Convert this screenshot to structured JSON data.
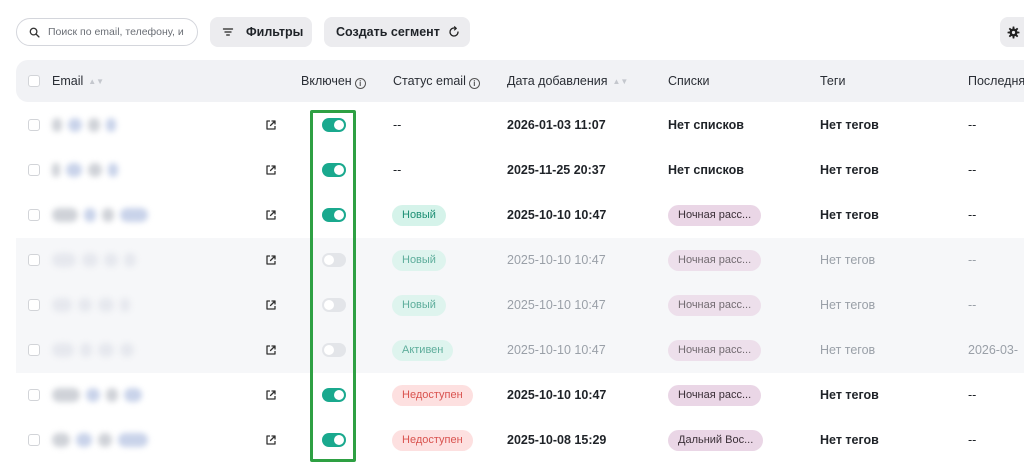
{
  "toolbar": {
    "search_placeholder": "Поиск по email, телефону, и",
    "filters_label": "Фильтры",
    "create_segment_label": "Создать сегмент"
  },
  "table": {
    "headers": {
      "email": "Email",
      "enabled": "Включен",
      "email_status": "Статус email",
      "date_added": "Дата добавления",
      "lists": "Списки",
      "tags": "Теги",
      "last": "Последня"
    },
    "rows": [
      {
        "enabled": true,
        "status": "--",
        "date": "2026-01-03 11:07",
        "list": "Нет списков",
        "tags": "Нет тегов",
        "last": "--"
      },
      {
        "enabled": true,
        "status": "--",
        "date": "2025-11-25 20:37",
        "list": "Нет списков",
        "tags": "Нет тегов",
        "last": "--"
      },
      {
        "enabled": true,
        "status": "Новый",
        "date": "2025-10-10 10:47",
        "list": "Ночная расс...",
        "tags": "Нет тегов",
        "last": "--"
      },
      {
        "enabled": false,
        "status": "Новый",
        "date": "2025-10-10 10:47",
        "list": "Ночная расс...",
        "tags": "Нет тегов",
        "last": "--"
      },
      {
        "enabled": false,
        "status": "Новый",
        "date": "2025-10-10 10:47",
        "list": "Ночная расс...",
        "tags": "Нет тегов",
        "last": "--"
      },
      {
        "enabled": false,
        "status": "Активен",
        "date": "2025-10-10 10:47",
        "list": "Ночная расс...",
        "tags": "Нет тегов",
        "last": "2026-03-"
      },
      {
        "enabled": true,
        "status": "Недоступен",
        "date": "2025-10-10 10:47",
        "list": "Ночная расс...",
        "tags": "Нет тегов",
        "last": "--"
      },
      {
        "enabled": true,
        "status": "Недоступен",
        "date": "2025-10-08 15:29",
        "list": "Дальний Вос...",
        "tags": "Нет тегов",
        "last": "--"
      }
    ]
  },
  "colors": {
    "toggle_on": "#1aa98e",
    "toggle_off": "#e3e5e9",
    "badge_new_bg": "#d5f3ea",
    "badge_new_fg": "#1d8f74",
    "badge_unavailable_bg": "#fde0e0",
    "badge_unavailable_fg": "#d9534f",
    "badge_list_bg": "#ead6e6",
    "badge_list_fg": "#3a2f37",
    "highlight": "#2ea043"
  }
}
